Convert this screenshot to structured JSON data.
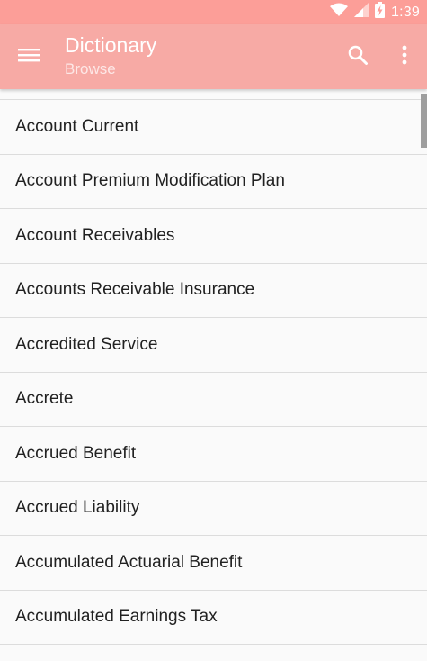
{
  "status_bar": {
    "time": "1:39",
    "icons": [
      "wifi-icon",
      "cellular-signal-icon",
      "battery-charging-icon"
    ]
  },
  "app_bar": {
    "title": "Dictionary",
    "subtitle": "Browse",
    "icons": [
      "hamburger-menu-icon",
      "search-icon",
      "more-vert-icon"
    ]
  },
  "terms": [
    "Account Current",
    "Account Premium Modification Plan",
    "Account Receivables",
    "Accounts Receivable Insurance",
    "Accredited Service",
    "Accrete",
    "Accrued Benefit",
    "Accrued Liability",
    "Accumulated Actuarial Benefit",
    "Accumulated Earnings Tax"
  ],
  "colors": {
    "status_bar": "#fc9e98",
    "app_bar": "#f7aaa5",
    "list_background": "#fafafa",
    "divider": "#dcdcdc",
    "text": "#212121"
  }
}
